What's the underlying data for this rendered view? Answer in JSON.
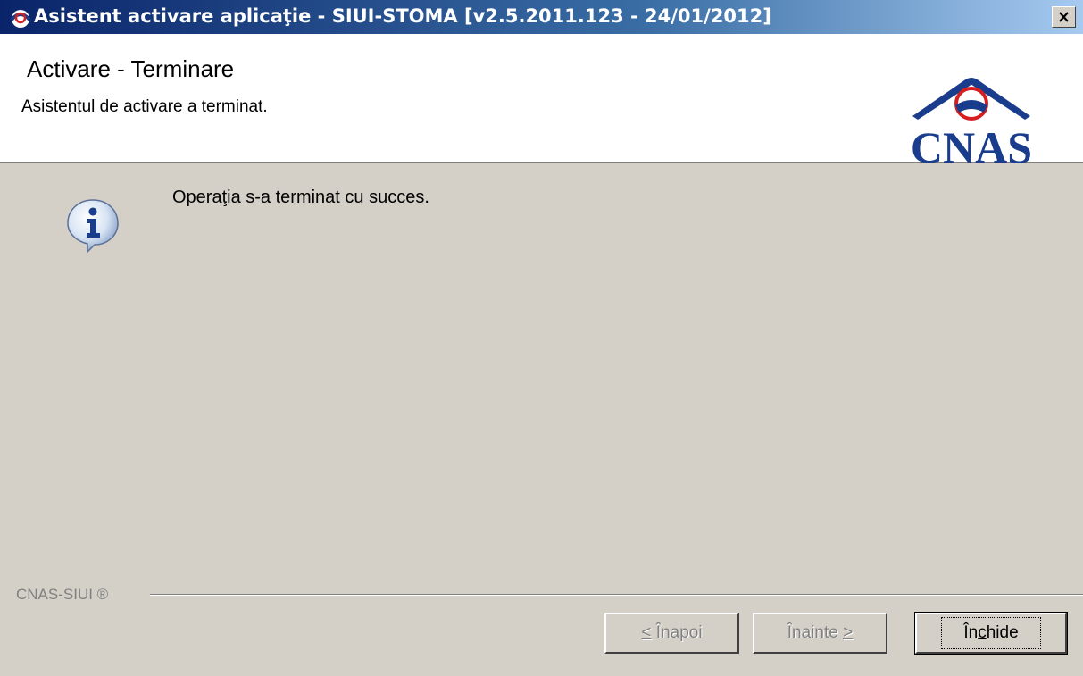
{
  "window": {
    "title": "Asistent activare aplicaţie - SIUI-STOMA [v2.5.2011.123 - 24/01/2012]",
    "close_icon": "close-icon"
  },
  "header": {
    "title": "Activare - Terminare",
    "subtitle": "Asistentul de activare a terminat.",
    "logo_text": "CNAS"
  },
  "body": {
    "message": "Operaţia s-a terminat cu succes.",
    "icon": "info-icon"
  },
  "footer": {
    "label": "CNAS-SIUI ®"
  },
  "buttons": {
    "back_mnemonic": "<",
    "back_rest": " Înapoi",
    "next_rest": "Înainte ",
    "next_mnemonic": ">",
    "close_pre": "În",
    "close_mnemonic": "c",
    "close_post": "hide"
  },
  "colors": {
    "titlebar_start": "#0a246a",
    "titlebar_end": "#a6caf0",
    "dialog_bg": "#d4d0c8",
    "logo_blue": "#1a3c8c",
    "logo_red": "#d42020"
  }
}
